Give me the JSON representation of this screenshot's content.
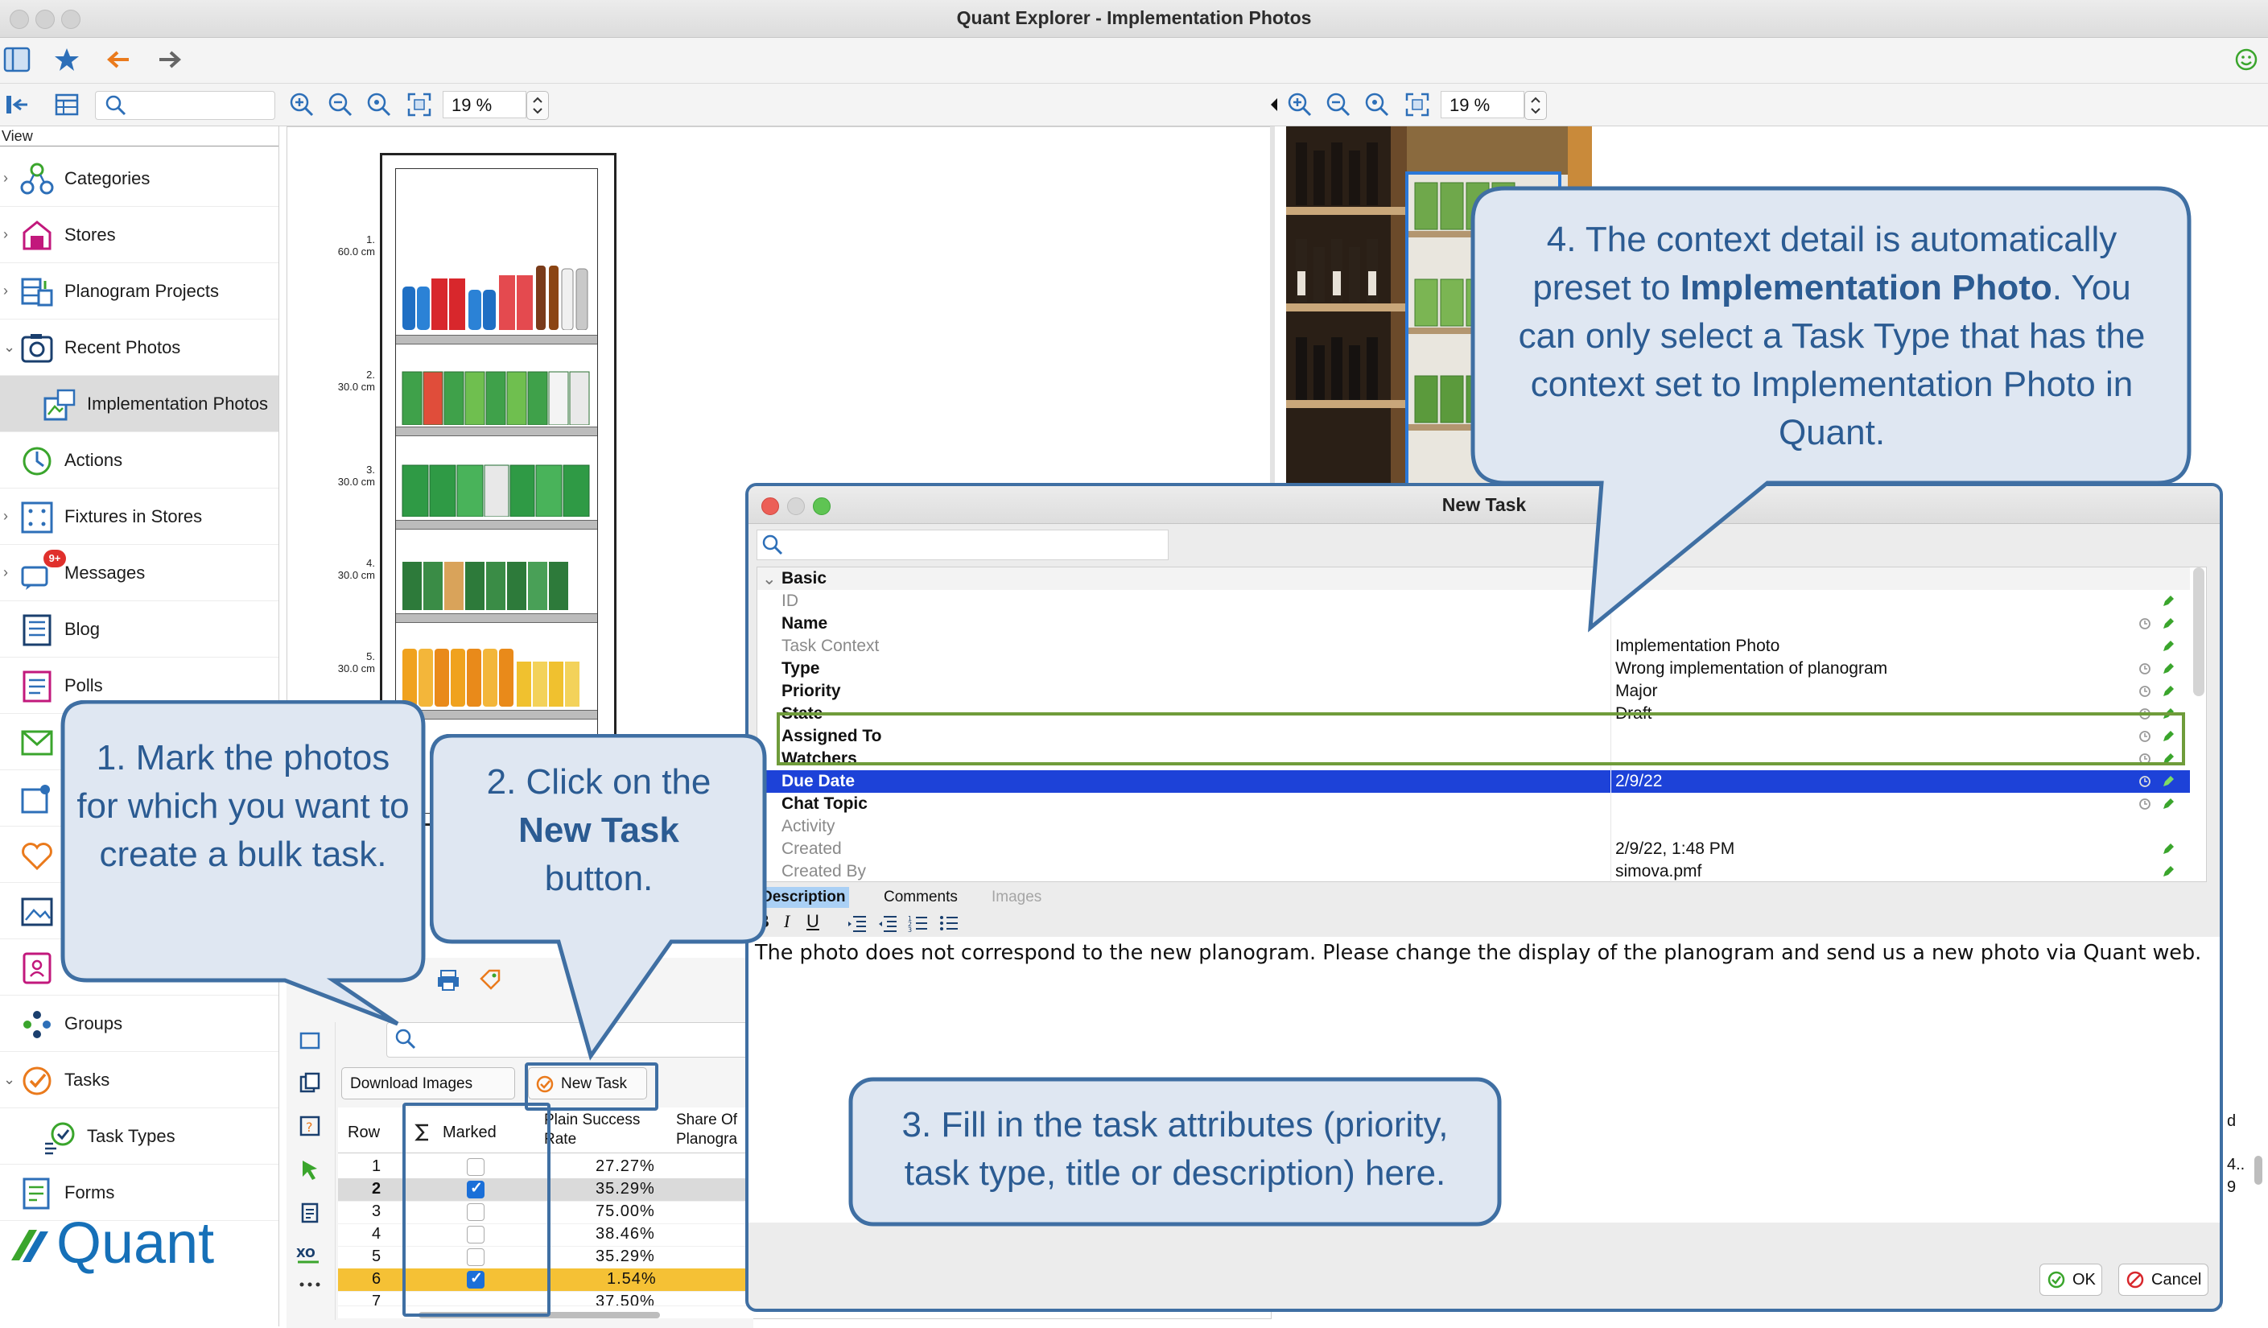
{
  "app": {
    "title": "Quant Explorer - Implementation Photos"
  },
  "toolbar": {
    "zoom_left": "19 %",
    "zoom_right": "19 %"
  },
  "sidebar": {
    "view_label": "View",
    "items": [
      {
        "label": "Categories"
      },
      {
        "label": "Stores"
      },
      {
        "label": "Planogram Projects"
      },
      {
        "label": "Recent Photos"
      },
      {
        "label": "Implementation Photos"
      },
      {
        "label": "Actions"
      },
      {
        "label": "Fixtures in Stores"
      },
      {
        "label": "Messages",
        "badge": "9+"
      },
      {
        "label": "Blog"
      },
      {
        "label": "Polls"
      },
      {
        "label": "Groups"
      },
      {
        "label": "Tasks"
      },
      {
        "label": "Task Types"
      },
      {
        "label": "Forms"
      }
    ],
    "logo": "Quant"
  },
  "planogram": {
    "shelves": [
      {
        "num": "1.",
        "size": "60.0 cm"
      },
      {
        "num": "2.",
        "size": "30.0 cm"
      },
      {
        "num": "3.",
        "size": "30.0 cm"
      },
      {
        "num": "4.",
        "size": "30.0 cm"
      },
      {
        "num": "5.",
        "size": "30.0 cm"
      }
    ]
  },
  "lower": {
    "download_label": "Download Images",
    "new_task_label": "New Task",
    "columns": [
      "Row",
      "Marked",
      "Plain Success Rate",
      "Share Of Planogra"
    ],
    "rows": [
      {
        "row": "1",
        "marked": false,
        "rate": "27.27%"
      },
      {
        "row": "2",
        "marked": true,
        "rate": "35.29%"
      },
      {
        "row": "3",
        "marked": false,
        "rate": "75.00%"
      },
      {
        "row": "4",
        "marked": false,
        "rate": "38.46%"
      },
      {
        "row": "5",
        "marked": false,
        "rate": "35.29%"
      },
      {
        "row": "6",
        "marked": true,
        "rate": "1.54%"
      }
    ],
    "partial_row": "7",
    "partial_rate": "37.50%",
    "right_col_header": "d",
    "right_col_values": [
      "4..",
      "9"
    ]
  },
  "dialog": {
    "title": "New Task",
    "section": "Basic",
    "props": [
      {
        "key": "ID",
        "value": ""
      },
      {
        "key": "Name",
        "value": ""
      },
      {
        "key": "Task Context",
        "value": "Implementation Photo"
      },
      {
        "key": "Type",
        "value": "Wrong implementation of planogram"
      },
      {
        "key": "Priority",
        "value": "Major"
      },
      {
        "key": "State",
        "value": "Draft"
      },
      {
        "key": "Assigned To",
        "value": ""
      },
      {
        "key": "Watchers",
        "value": ""
      },
      {
        "key": "Due Date",
        "value": "2/9/22"
      },
      {
        "key": "Chat Topic",
        "value": ""
      },
      {
        "key": "Activity",
        "value": ""
      },
      {
        "key": "Created",
        "value": "2/9/22, 1:48 PM"
      },
      {
        "key": "Created By",
        "value": "simova.pmf"
      }
    ],
    "tabs": [
      "Description",
      "Comments",
      "Images"
    ],
    "description": "The photo does not correspond to the new planogram. Please change the display of the planogram and send us a new photo via Quant web.",
    "ok_label": "OK",
    "cancel_label": "Cancel"
  },
  "callouts": {
    "c1": "1. Mark the photos for which you want to create a bulk task.",
    "c2_pre": "2. Click on the",
    "c2_bold": "New Task",
    "c2_post": "button.",
    "c3": "3. Fill in the task attributes (priority, task type, title or description) here.",
    "c4_pre": "4. The context detail is automatically preset to",
    "c4_bold": "Implementation Photo",
    "c4_post": ". You can only select a Task Type that has the context set to Implementation Photo in Quant."
  },
  "colors": {
    "callout_blue": "#3f6fa3",
    "callout_fill": "#dfe7f2",
    "selection_blue": "#1d42d8",
    "context_green": "#6f9c3a",
    "marked_row": "#f5c135"
  }
}
